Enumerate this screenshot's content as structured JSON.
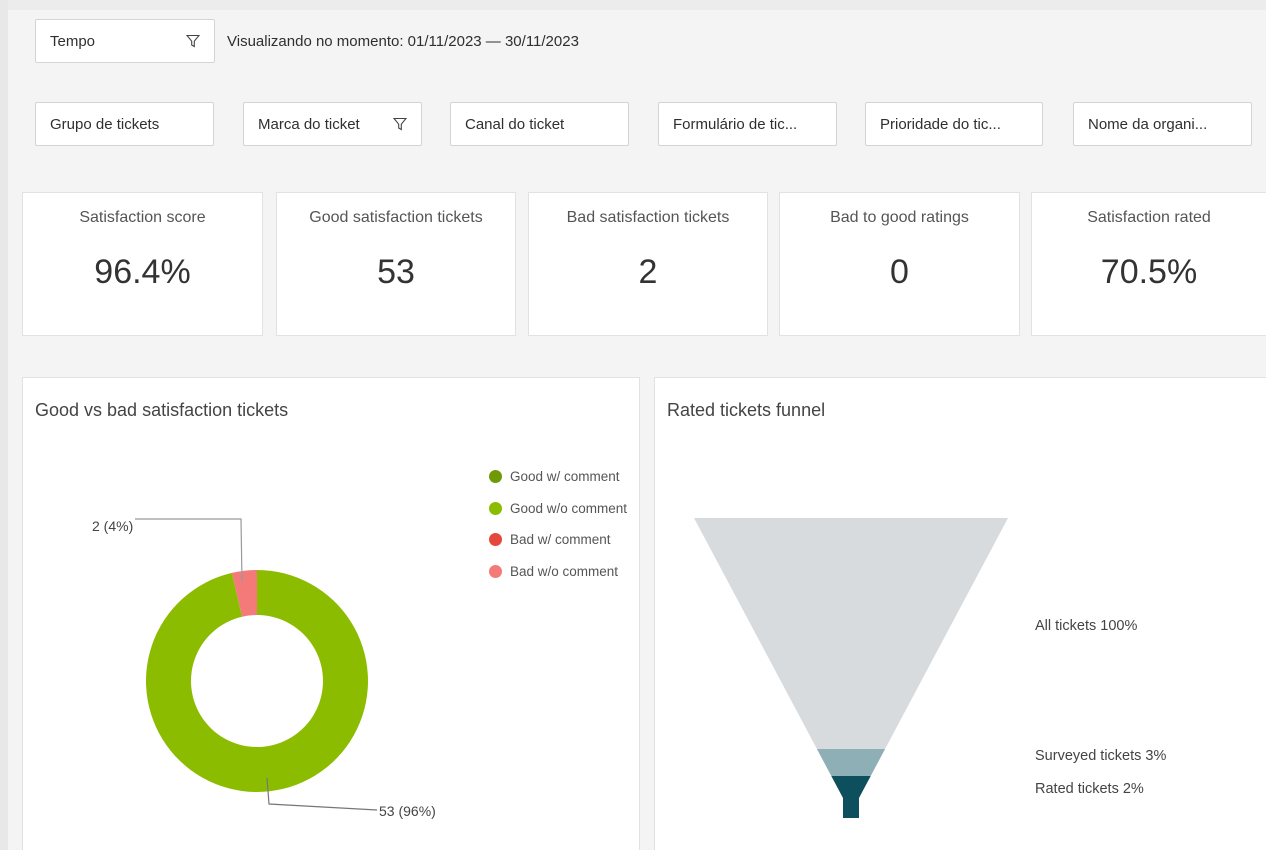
{
  "filters": {
    "time": {
      "label": "Tempo"
    },
    "viewing_text": "Visualizando no momento: 01/11/2023 — 30/11/2023",
    "row": [
      {
        "label": "Grupo de tickets",
        "has_filter_icon": false
      },
      {
        "label": "Marca do ticket",
        "has_filter_icon": true
      },
      {
        "label": "Canal do ticket",
        "has_filter_icon": false
      },
      {
        "label": "Formulário de tic...",
        "has_filter_icon": false
      },
      {
        "label": "Prioridade do tic...",
        "has_filter_icon": false
      },
      {
        "label": "Nome da organi...",
        "has_filter_icon": false
      }
    ]
  },
  "kpis": [
    {
      "title": "Satisfaction score",
      "value": "96.4%"
    },
    {
      "title": "Good satisfaction tickets",
      "value": "53"
    },
    {
      "title": "Bad satisfaction tickets",
      "value": "2"
    },
    {
      "title": "Bad to good ratings",
      "value": "0"
    },
    {
      "title": "Satisfaction rated",
      "value": "70.5%"
    }
  ],
  "donut_panel": {
    "title": "Good vs bad satisfaction tickets",
    "legend": [
      {
        "label": "Good w/ comment",
        "color": "#6f9a06"
      },
      {
        "label": "Good w/o comment",
        "color": "#8cbc00"
      },
      {
        "label": "Bad w/ comment",
        "color": "#e5473c"
      },
      {
        "label": "Bad w/o comment",
        "color": "#f47a7a"
      }
    ],
    "slice_labels": {
      "bad": "2 (4%)",
      "good": "53 (96%)"
    }
  },
  "funnel_panel": {
    "title": "Rated tickets funnel",
    "labels": {
      "all": "All tickets 100%",
      "surveyed": "Surveyed tickets 3%",
      "rated": "Rated tickets 2%"
    },
    "colors": {
      "all": "#d7dbde",
      "surveyed": "#8eafb6",
      "rated": "#0d4f5c"
    }
  },
  "chart_data": [
    {
      "type": "pie",
      "title": "Good vs bad satisfaction tickets",
      "categories": [
        "Good w/ comment",
        "Good w/o comment",
        "Bad w/ comment",
        "Bad w/o comment"
      ],
      "values": [
        0,
        53,
        0,
        2
      ],
      "colors": [
        "#6f9a06",
        "#8cbc00",
        "#e5473c",
        "#f47a7a"
      ],
      "data_labels": [
        "",
        "53 (96%)",
        "",
        "2 (4%)"
      ],
      "legend": "right"
    },
    {
      "type": "bar",
      "title": "Rated tickets funnel",
      "categories": [
        "All tickets",
        "Surveyed tickets",
        "Rated tickets"
      ],
      "values": [
        100,
        3,
        2
      ],
      "colors": [
        "#d7dbde",
        "#8eafb6",
        "#0d4f5c"
      ],
      "data_labels": [
        "All tickets 100%",
        "Surveyed tickets 3%",
        "Rated tickets 2%"
      ]
    }
  ]
}
